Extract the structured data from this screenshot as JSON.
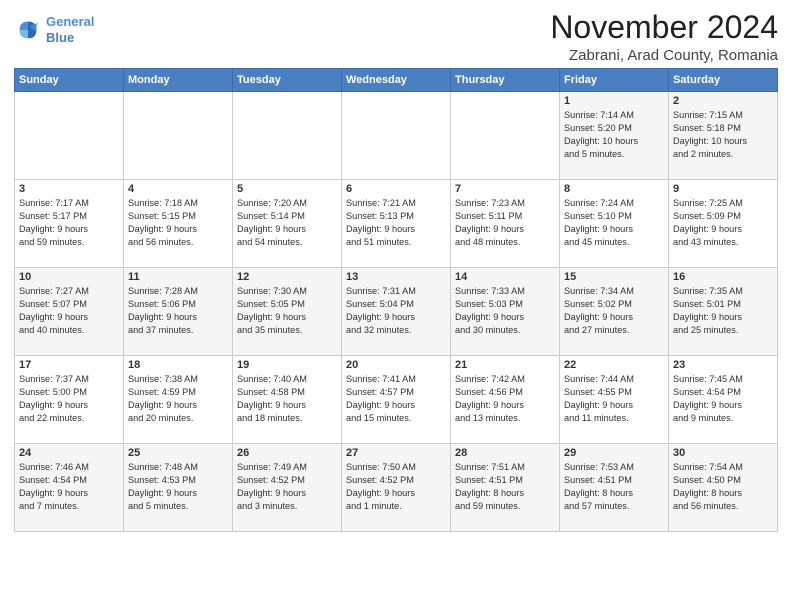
{
  "header": {
    "logo_line1": "General",
    "logo_line2": "Blue",
    "month": "November 2024",
    "location": "Zabrani, Arad County, Romania"
  },
  "weekdays": [
    "Sunday",
    "Monday",
    "Tuesday",
    "Wednesday",
    "Thursday",
    "Friday",
    "Saturday"
  ],
  "weeks": [
    [
      {
        "day": "",
        "info": ""
      },
      {
        "day": "",
        "info": ""
      },
      {
        "day": "",
        "info": ""
      },
      {
        "day": "",
        "info": ""
      },
      {
        "day": "",
        "info": ""
      },
      {
        "day": "1",
        "info": "Sunrise: 7:14 AM\nSunset: 5:20 PM\nDaylight: 10 hours\nand 5 minutes."
      },
      {
        "day": "2",
        "info": "Sunrise: 7:15 AM\nSunset: 5:18 PM\nDaylight: 10 hours\nand 2 minutes."
      }
    ],
    [
      {
        "day": "3",
        "info": "Sunrise: 7:17 AM\nSunset: 5:17 PM\nDaylight: 9 hours\nand 59 minutes."
      },
      {
        "day": "4",
        "info": "Sunrise: 7:18 AM\nSunset: 5:15 PM\nDaylight: 9 hours\nand 56 minutes."
      },
      {
        "day": "5",
        "info": "Sunrise: 7:20 AM\nSunset: 5:14 PM\nDaylight: 9 hours\nand 54 minutes."
      },
      {
        "day": "6",
        "info": "Sunrise: 7:21 AM\nSunset: 5:13 PM\nDaylight: 9 hours\nand 51 minutes."
      },
      {
        "day": "7",
        "info": "Sunrise: 7:23 AM\nSunset: 5:11 PM\nDaylight: 9 hours\nand 48 minutes."
      },
      {
        "day": "8",
        "info": "Sunrise: 7:24 AM\nSunset: 5:10 PM\nDaylight: 9 hours\nand 45 minutes."
      },
      {
        "day": "9",
        "info": "Sunrise: 7:25 AM\nSunset: 5:09 PM\nDaylight: 9 hours\nand 43 minutes."
      }
    ],
    [
      {
        "day": "10",
        "info": "Sunrise: 7:27 AM\nSunset: 5:07 PM\nDaylight: 9 hours\nand 40 minutes."
      },
      {
        "day": "11",
        "info": "Sunrise: 7:28 AM\nSunset: 5:06 PM\nDaylight: 9 hours\nand 37 minutes."
      },
      {
        "day": "12",
        "info": "Sunrise: 7:30 AM\nSunset: 5:05 PM\nDaylight: 9 hours\nand 35 minutes."
      },
      {
        "day": "13",
        "info": "Sunrise: 7:31 AM\nSunset: 5:04 PM\nDaylight: 9 hours\nand 32 minutes."
      },
      {
        "day": "14",
        "info": "Sunrise: 7:33 AM\nSunset: 5:03 PM\nDaylight: 9 hours\nand 30 minutes."
      },
      {
        "day": "15",
        "info": "Sunrise: 7:34 AM\nSunset: 5:02 PM\nDaylight: 9 hours\nand 27 minutes."
      },
      {
        "day": "16",
        "info": "Sunrise: 7:35 AM\nSunset: 5:01 PM\nDaylight: 9 hours\nand 25 minutes."
      }
    ],
    [
      {
        "day": "17",
        "info": "Sunrise: 7:37 AM\nSunset: 5:00 PM\nDaylight: 9 hours\nand 22 minutes."
      },
      {
        "day": "18",
        "info": "Sunrise: 7:38 AM\nSunset: 4:59 PM\nDaylight: 9 hours\nand 20 minutes."
      },
      {
        "day": "19",
        "info": "Sunrise: 7:40 AM\nSunset: 4:58 PM\nDaylight: 9 hours\nand 18 minutes."
      },
      {
        "day": "20",
        "info": "Sunrise: 7:41 AM\nSunset: 4:57 PM\nDaylight: 9 hours\nand 15 minutes."
      },
      {
        "day": "21",
        "info": "Sunrise: 7:42 AM\nSunset: 4:56 PM\nDaylight: 9 hours\nand 13 minutes."
      },
      {
        "day": "22",
        "info": "Sunrise: 7:44 AM\nSunset: 4:55 PM\nDaylight: 9 hours\nand 11 minutes."
      },
      {
        "day": "23",
        "info": "Sunrise: 7:45 AM\nSunset: 4:54 PM\nDaylight: 9 hours\nand 9 minutes."
      }
    ],
    [
      {
        "day": "24",
        "info": "Sunrise: 7:46 AM\nSunset: 4:54 PM\nDaylight: 9 hours\nand 7 minutes."
      },
      {
        "day": "25",
        "info": "Sunrise: 7:48 AM\nSunset: 4:53 PM\nDaylight: 9 hours\nand 5 minutes."
      },
      {
        "day": "26",
        "info": "Sunrise: 7:49 AM\nSunset: 4:52 PM\nDaylight: 9 hours\nand 3 minutes."
      },
      {
        "day": "27",
        "info": "Sunrise: 7:50 AM\nSunset: 4:52 PM\nDaylight: 9 hours\nand 1 minute."
      },
      {
        "day": "28",
        "info": "Sunrise: 7:51 AM\nSunset: 4:51 PM\nDaylight: 8 hours\nand 59 minutes."
      },
      {
        "day": "29",
        "info": "Sunrise: 7:53 AM\nSunset: 4:51 PM\nDaylight: 8 hours\nand 57 minutes."
      },
      {
        "day": "30",
        "info": "Sunrise: 7:54 AM\nSunset: 4:50 PM\nDaylight: 8 hours\nand 56 minutes."
      }
    ]
  ]
}
